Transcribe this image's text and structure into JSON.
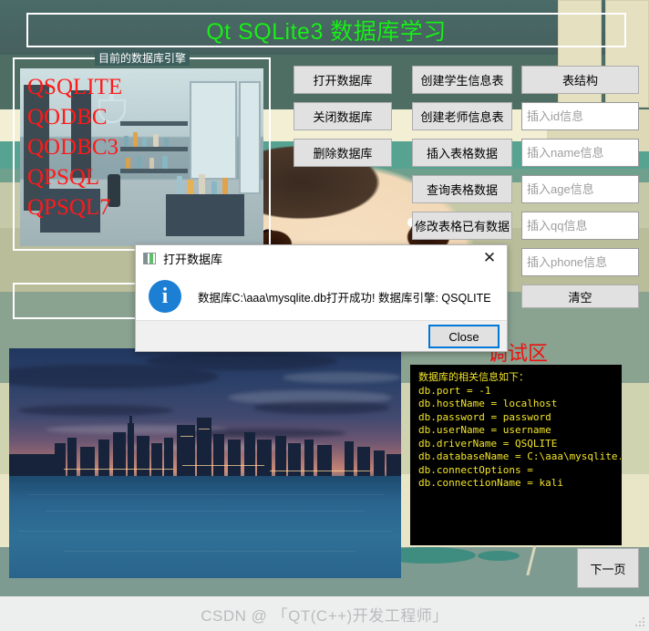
{
  "window": {
    "title": "Qt SQLite3 数据库学习"
  },
  "engine_group": {
    "title": "目前的数据库引擎",
    "engines_text": "QSQLITE\nQODBC\nQODBC3\nQPSQL\nQPSQL7",
    "engines": [
      "QSQLITE",
      "QODBC",
      "QODBC3",
      "QPSQL",
      "QPSQL7"
    ]
  },
  "actions": {
    "open_db": "打开数据库",
    "close_db": "关闭数据库",
    "delete_db": "删除数据库",
    "create_student_table": "创建学生信息表",
    "create_teacher_table": "创建老师信息表",
    "insert_table_data": "插入表格数据",
    "query_table_data": "查询表格数据",
    "modify_table_data": "修改表格已有数据",
    "table_structure": "表结构",
    "clear": "清空",
    "next_page": "下一页"
  },
  "fields": [
    {
      "name": "id",
      "placeholder": "插入id信息",
      "value": ""
    },
    {
      "name": "name",
      "placeholder": "插入name信息",
      "value": ""
    },
    {
      "name": "age",
      "placeholder": "插入age信息",
      "value": ""
    },
    {
      "name": "qq",
      "placeholder": "插入qq信息",
      "value": ""
    },
    {
      "name": "phone",
      "placeholder": "插入phone信息",
      "value": ""
    }
  ],
  "lone_field": {
    "placeholder": "",
    "value": ""
  },
  "debug": {
    "label": "调试区",
    "console_text": "数据库的相关信息如下：\ndb.port = -1\ndb.hostName = localhost\ndb.password = password\ndb.userName = username\ndb.driverName = QSQLITE\ndb.databaseName = C:\\aaa\\mysqlite.db\ndb.connectOptions =\ndb.connectionName = kali",
    "console_lines": [
      "数据库的相关信息如下：",
      "db.port = -1",
      "db.hostName = localhost",
      "db.password = password",
      "db.userName = username",
      "db.driverName = QSQLITE",
      "db.databaseName = C:\\aaa\\mysqlite.db",
      "db.connectOptions =",
      "db.connectionName = kali"
    ]
  },
  "dialog": {
    "title": "打开数据库",
    "icon": "info-icon",
    "message": "数据库C:\\aaa\\mysqlite.db打开成功!  数据库引擎:  QSQLITE",
    "close_button": "Close",
    "close_x": "✕"
  },
  "watermark": {
    "text": "CSDN @ 「QT(C++)开发工程师」"
  },
  "colors": {
    "title_green": "#19ef19",
    "engine_red": "#ff1a1a",
    "debug_red": "#ee1111",
    "console_bg": "#000000",
    "console_fg": "#f2e42a",
    "dialog_accent": "#0078d7",
    "info_blue": "#1c7fd4",
    "button_face": "#e1e1e1"
  }
}
